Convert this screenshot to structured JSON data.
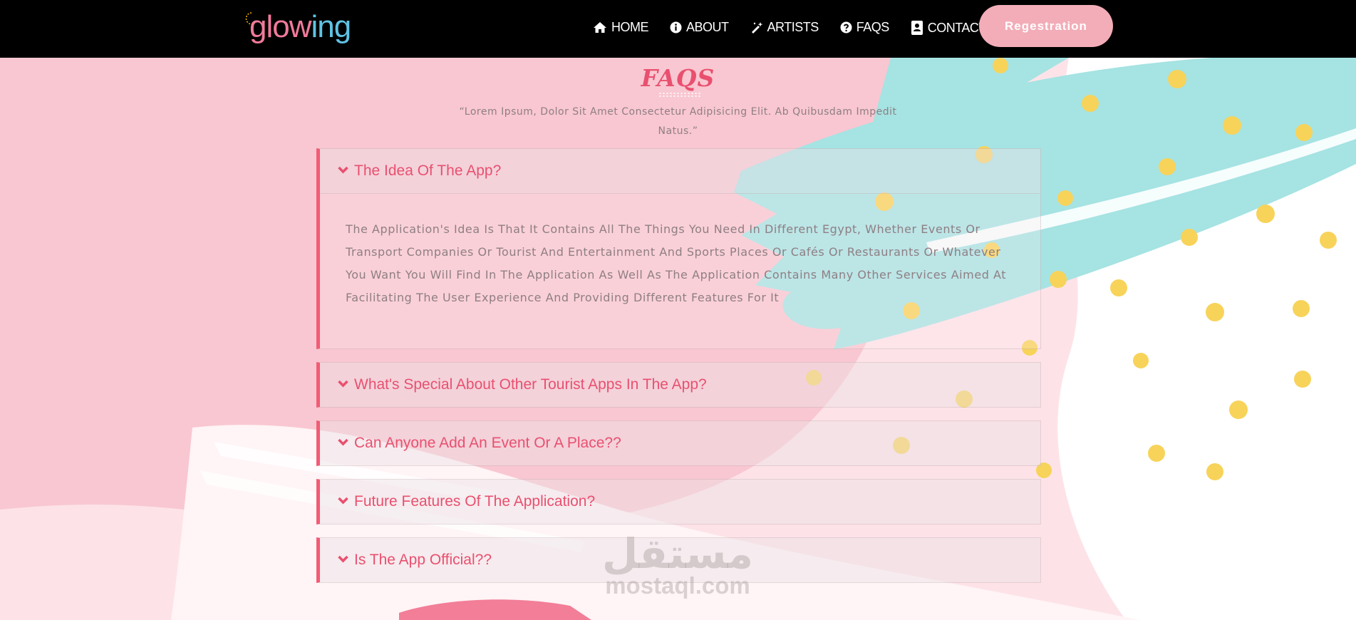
{
  "brand": {
    "logo_text_a": "glow",
    "logo_text_b": "ing"
  },
  "nav": {
    "items": [
      {
        "label": "HOME",
        "icon": "home-icon"
      },
      {
        "label": "ABOUT",
        "icon": "info-circle-icon"
      },
      {
        "label": "ARTISTS",
        "icon": "magic-wand-icon"
      },
      {
        "label": "FAQS",
        "icon": "question-circle-icon"
      },
      {
        "label": "CONTACT",
        "icon": "contact-card-icon"
      }
    ],
    "register_label": "Regestration"
  },
  "faq_section": {
    "title": "FAQS",
    "subtitle": "“Lorem Ipsum, Dolor Sit Amet Consectetur Adipisicing Elit. Ab Quibusdam Impedit Natus.”",
    "items": [
      {
        "question": "The Idea Of The App?",
        "expanded": true,
        "answer": "The Application's Idea Is That It Contains All The Things You Need In Different Egypt, Whether Events Or Transport Companies Or Tourist And Entertainment And Sports Places Or Cafés Or Restaurants Or Whatever You Want You Will Find In The Application As Well As The Application Contains Many Other Services Aimed At Facilitating The User Experience And Providing Different Features For It"
      },
      {
        "question": "What's Special About Other Tourist Apps In The App?",
        "expanded": false
      },
      {
        "question": "Can Anyone Add An Event Or A Place??",
        "expanded": false
      },
      {
        "question": "Future Features Of The Application?",
        "expanded": false
      },
      {
        "question": "Is The App Official??",
        "expanded": false
      }
    ]
  },
  "watermark": {
    "arabic": "مستقل",
    "latin": "mostaql.com"
  },
  "colors": {
    "accent": "#e9506f",
    "accent_border": "#f35b75",
    "register_bg": "#f3adb8",
    "navbar_bg": "#000000",
    "background_pink": "#fde3e8",
    "brush_teal": "#a6e3e3",
    "dots_yellow": "#f7d35a"
  }
}
